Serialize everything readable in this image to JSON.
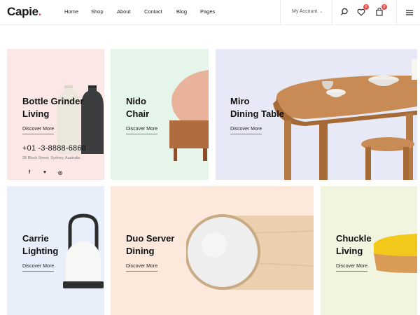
{
  "brand": {
    "name": "Capie",
    "dot": ".",
    "accent": "#e8504a"
  },
  "nav": [
    "Home",
    "Shop",
    "About",
    "Contact",
    "Blog",
    "Pages"
  ],
  "account": {
    "label": "My Account"
  },
  "icons": {
    "search": "search-icon",
    "wishlist": "heart-icon",
    "cart": "bag-icon",
    "menu": "hamburger-icon"
  },
  "badges": {
    "wishlist": "0",
    "cart": "0"
  },
  "cards": [
    {
      "line1": "Bottle Grinder",
      "line2": "Living",
      "link": "Discover More",
      "bg": "#fbe8e6"
    },
    {
      "line1": "Nido",
      "line2": "Chair",
      "link": "Discover More",
      "bg": "#e6f5ea"
    },
    {
      "line1": "Miro",
      "line2": "Dining Table",
      "link": "Discover More",
      "bg": "#e8e9f7"
    },
    {
      "line1": "Carrie",
      "line2": "Lighting",
      "link": "Discover More",
      "bg": "#e8effb"
    },
    {
      "line1": "Duo Server",
      "line2": "Dining",
      "link": "Discover More",
      "bg": "#fce9dc"
    },
    {
      "line1": "Chuckle",
      "line2": "Living",
      "link": "Discover More",
      "bg": "#f1f4df"
    }
  ],
  "contact": {
    "phone": "+01 -3-8888-6868",
    "address": "28 Block Street, Sydney, Australia"
  },
  "social": [
    "f",
    "♥",
    "◎"
  ]
}
